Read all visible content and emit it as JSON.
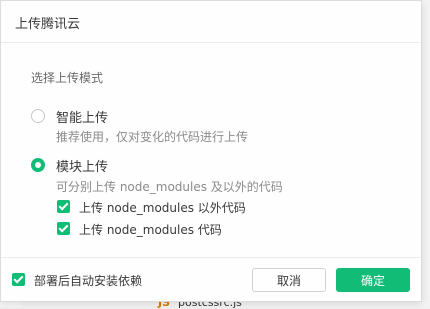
{
  "dialog": {
    "title": "上传腾讯云",
    "section_label": "选择上传模式",
    "options": [
      {
        "title": "智能上传",
        "description": "推荐使用，仅对变化的代码进行上传",
        "selected": false
      },
      {
        "title": "模块上传",
        "description": "可分别上传 node_modules 及以外的代码",
        "selected": true
      }
    ],
    "sub_options": [
      {
        "label": "上传 node_modules 以外代码",
        "checked": true
      },
      {
        "label": "上传 node_modules 代码",
        "checked": true
      }
    ],
    "footer": {
      "auto_install_label": "部署后自动安装依赖",
      "auto_install_checked": true,
      "cancel_label": "取消",
      "ok_label": "确定"
    }
  },
  "background": {
    "file_type": "JS",
    "file_name": "postcssrc.js"
  },
  "colors": {
    "accent": "#09bb72",
    "text": "#333333",
    "muted": "#888888"
  }
}
